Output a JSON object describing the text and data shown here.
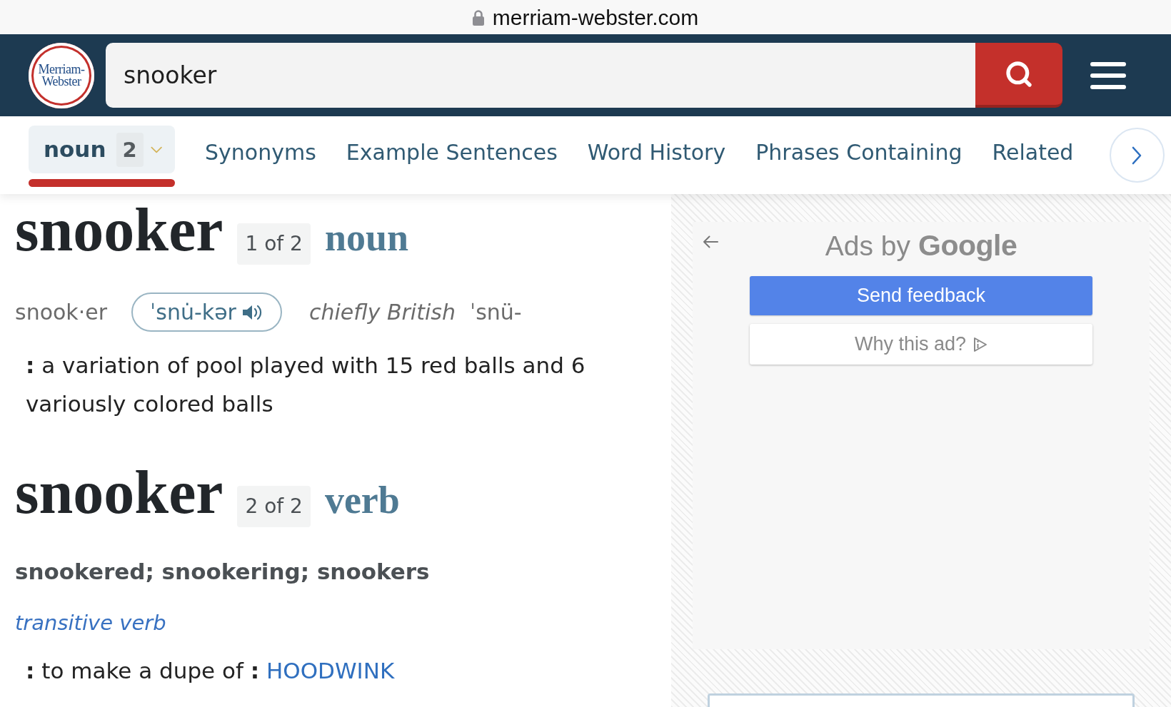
{
  "browser": {
    "url": "merriam-webster.com"
  },
  "header": {
    "logo": "Merriam-Webster",
    "search": {
      "value": "snooker"
    }
  },
  "nav": {
    "tabs": [
      {
        "kind": "dropdown",
        "label": "noun",
        "count": "2",
        "selected": true
      },
      {
        "kind": "link",
        "label": "Synonyms",
        "selected": false
      },
      {
        "kind": "link",
        "label": "Example Sentences",
        "selected": false
      },
      {
        "kind": "link",
        "label": "Word History",
        "selected": false
      },
      {
        "kind": "link",
        "label": "Phrases Containing",
        "selected": false
      },
      {
        "kind": "link",
        "label": "Related",
        "selected": false
      }
    ]
  },
  "entries": [
    {
      "headword": "snooker",
      "badge": "1 of 2",
      "part_of_speech": "noun",
      "syllables": "snook·er",
      "pronunciation": "ˈsnu̇-kər",
      "variant": {
        "label": "chiefly British",
        "pronunciation": "ˈsnü-"
      },
      "senses": [
        {
          "text": "**:** a variation of pool played with 15 red balls and 6 variously colored balls"
        }
      ]
    },
    {
      "headword": "snooker",
      "badge": "2 of 2",
      "part_of_speech": "verb",
      "inflections": "snookered; snookering; snookers",
      "function_label": "transitive verb",
      "senses": [
        {
          "text": "**:** to make a dupe of **:**",
          "link": "HOODWINK"
        }
      ]
    }
  ],
  "ad": {
    "title": "Ads by",
    "brand": "Google",
    "buttons": [
      {
        "kind": "primary",
        "label": "Send feedback"
      },
      {
        "kind": "secondary",
        "label": "Why this ad?"
      }
    ]
  }
}
